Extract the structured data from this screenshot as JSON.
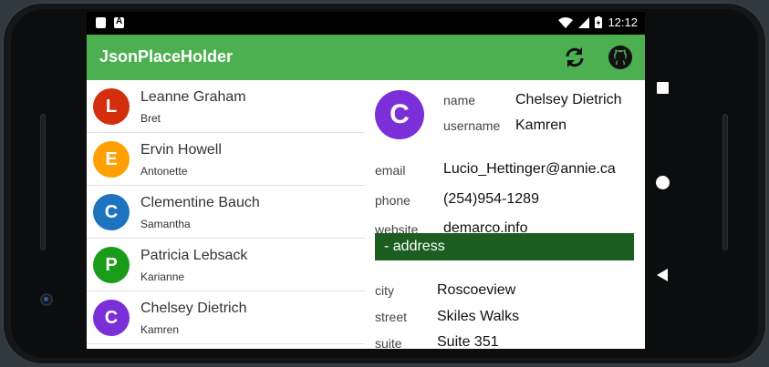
{
  "statusbar": {
    "time": "12:12"
  },
  "appbar": {
    "title": "JsonPlaceHolder",
    "refresh_icon": "refresh-icon",
    "github_icon": "github-icon"
  },
  "users": [
    {
      "initial": "L",
      "name": "Leanne Graham",
      "username": "Bret",
      "color": "#d32f0f"
    },
    {
      "initial": "E",
      "name": "Ervin Howell",
      "username": "Antonette",
      "color": "#ffa000"
    },
    {
      "initial": "C",
      "name": "Clementine Bauch",
      "username": "Samantha",
      "color": "#1e73be"
    },
    {
      "initial": "P",
      "name": "Patricia Lebsack",
      "username": "Karianne",
      "color": "#1a9b1a"
    },
    {
      "initial": "C",
      "name": "Chelsey Dietrich",
      "username": "Kamren",
      "color": "#7b2fd8"
    }
  ],
  "detail": {
    "initial": "C",
    "avatar_color": "#7b2fd8",
    "name_label": "name",
    "name": "Chelsey Dietrich",
    "username_label": "username",
    "username": "Kamren",
    "email_label": "email",
    "email": "Lucio_Hettinger@annie.ca",
    "phone_label": "phone",
    "phone": "(254)954-1289",
    "website_label": "website",
    "website": "demarco.info",
    "address_header": "- address",
    "city_label": "city",
    "city": "Roscoeview",
    "street_label": "street",
    "street": "Skiles Walks",
    "suite_label": "suite",
    "suite": "Suite 351"
  },
  "colors": {
    "appbar": "#4caf50",
    "address_bar": "#1b5e20"
  }
}
